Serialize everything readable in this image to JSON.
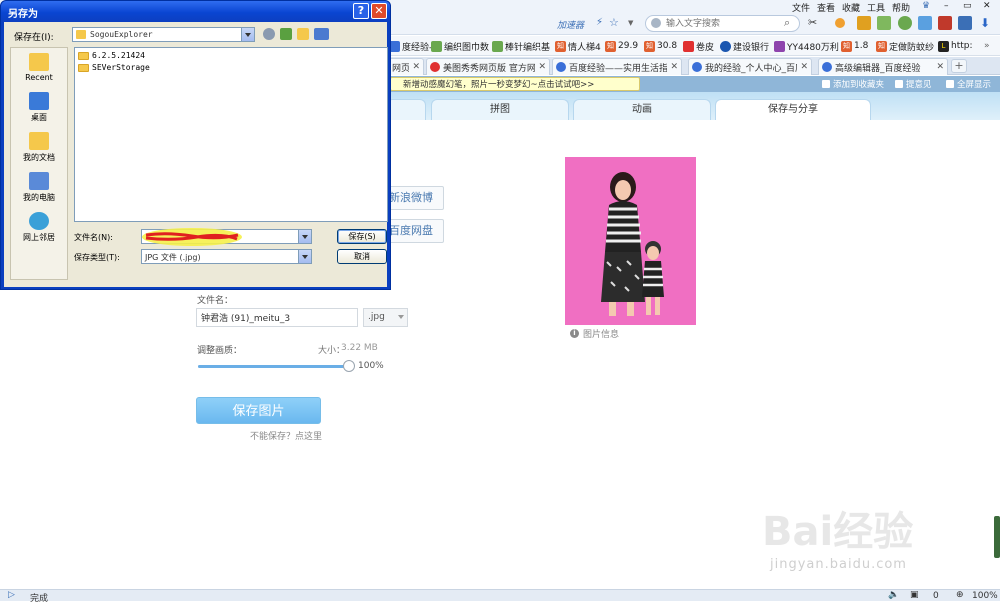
{
  "browser": {
    "menu": [
      "文件",
      "查看",
      "收藏",
      "工具",
      "帮助"
    ],
    "accelerator_label": "加速器",
    "search_placeholder": "输入文字搜索",
    "bookmarks": [
      {
        "label": "度经验-",
        "color": "#3a6fd8",
        "glyph": ""
      },
      {
        "label": "编织图巾数",
        "color": "#6aa84f",
        "glyph": ""
      },
      {
        "label": "棒针编织基",
        "color": "#6aa84f",
        "glyph": ""
      },
      {
        "label": "情人梯4",
        "color": "#e06030",
        "glyph": "知"
      },
      {
        "label": "29.9",
        "color": "#e06030",
        "glyph": "知"
      },
      {
        "label": "30.8",
        "color": "#e06030",
        "glyph": "知"
      },
      {
        "label": "卷皮",
        "color": "#e03030",
        "glyph": ""
      },
      {
        "label": "建设银行",
        "color": "#1a56b0",
        "glyph": ""
      },
      {
        "label": "YY4480万利",
        "color": "#8e44ad",
        "glyph": ""
      },
      {
        "label": "1.8",
        "color": "#e06030",
        "glyph": "知"
      },
      {
        "label": "定做防蚊纱",
        "color": "#e06030",
        "glyph": "知"
      },
      {
        "label": "http:",
        "color": "#222",
        "glyph": "L"
      }
    ],
    "tabs": [
      {
        "label": "网页",
        "color": "#3a6fd8"
      },
      {
        "label": "美图秀秀网页版 官方网站",
        "color": "#e03030"
      },
      {
        "label": "百度经验——实用生活指",
        "color": "#3a6fd8"
      },
      {
        "label": "我的经验_个人中心_百度",
        "color": "#3a6fd8"
      },
      {
        "label": "高级编辑器_百度经验",
        "color": "#3a6fd8"
      }
    ],
    "new_tab_label": "+",
    "notice": "新增动感魔幻笔，照片一秒变梦幻~点击试试吧>>",
    "notice_actions": [
      "添加到收藏夹",
      "提意见",
      "全屏显示"
    ],
    "status_text": "完成",
    "status_count": "0",
    "zoom": "100%"
  },
  "app": {
    "tabs": [
      "拼图",
      "动画",
      "保存与分享"
    ],
    "active_tab": "保存与分享",
    "share_buttons": [
      "新浪微博",
      "百度网盘"
    ],
    "photo_info": "图片信息",
    "filename_label": "文件名：",
    "filename_value": "钟君浩 (91)_meitu_3",
    "extension": ".jpg",
    "quality_label": "调整画质：",
    "size_label": "大小：",
    "size_value": "3.22 MB",
    "quality_percent": "100%",
    "quality_level": 1.0,
    "save_button": "保存图片",
    "cant_save": "不能保存？点这里",
    "watermark": "Bai经验",
    "watermark_url": "jingyan.baidu.com"
  },
  "dialog": {
    "title": "另存为",
    "save_in_label": "保存在(I):",
    "save_in_value": "SogouExplorer",
    "places": [
      "Recent",
      "桌面",
      "我的文档",
      "我的电脑",
      "网上邻居"
    ],
    "files": [
      "6.2.5.21424",
      "SEVerStorage"
    ],
    "filename_label": "文件名(N):",
    "filetype_label": "保存类型(T):",
    "filetype_value": "JPG 文件 (.jpg)",
    "save_button": "保存(S)",
    "cancel_button": "取消",
    "help_button": "?",
    "close_button": "✕"
  }
}
